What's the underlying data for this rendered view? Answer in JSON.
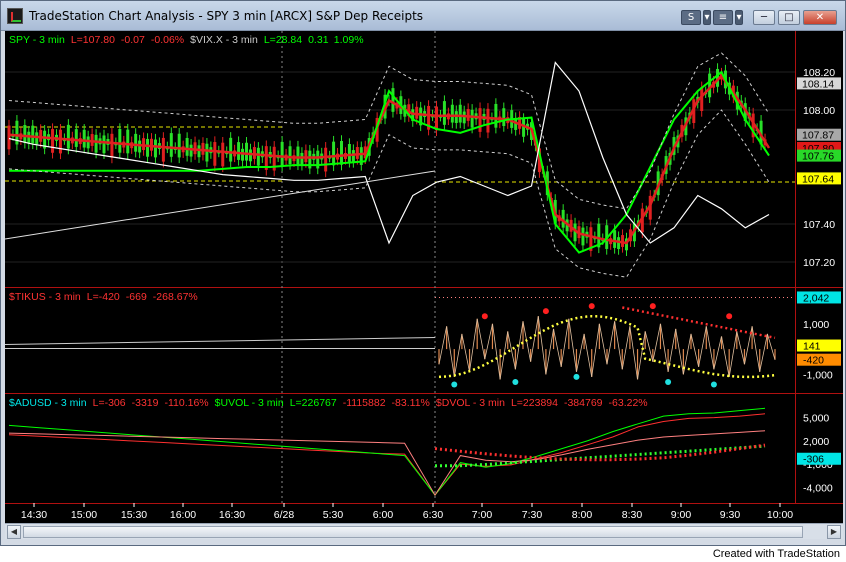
{
  "window": {
    "title": "TradeStation Chart Analysis - SPY 3 min [ARCX] S&P Dep Receipts",
    "btn_s": "S",
    "btn_menu": "≡"
  },
  "footer": "Created with TradeStation",
  "chart_data": [
    {
      "type": "line",
      "legend": [
        {
          "text": "SPY - 3 min",
          "color": "#00ff00"
        },
        {
          "text": "L=107.80",
          "color": "#ff3333"
        },
        {
          "text": "-0.07",
          "color": "#ff3333"
        },
        {
          "text": "-0.06%",
          "color": "#ff3333"
        },
        {
          "text": "$VIX.X - 3 min",
          "color": "#cccccc"
        },
        {
          "text": "L=28.84",
          "color": "#00ff00"
        },
        {
          "text": "0.31",
          "color": "#00ff00"
        },
        {
          "text": "1.09%",
          "color": "#00ff00"
        }
      ],
      "y_ticks": [
        "108.20",
        "108.00",
        "107.40",
        "107.20"
      ],
      "y_badges": [
        {
          "text": "108.14",
          "bg": "#d8d8d8",
          "fg": "#000000"
        },
        {
          "text": "107.87",
          "bg": "#a8a8a8",
          "fg": "#000000"
        },
        {
          "text": "107.80",
          "bg": "#e01818",
          "fg": "#000000"
        },
        {
          "text": "107.76",
          "bg": "#28d828",
          "fg": "#000000"
        },
        {
          "text": "107.64",
          "bg": "#ffff00",
          "fg": "#000000"
        }
      ],
      "ylim": [
        107.1,
        108.3
      ],
      "x": [
        0,
        3,
        6,
        9,
        12,
        15,
        18,
        21,
        24,
        27,
        30,
        33,
        36,
        39,
        42,
        45,
        48,
        51,
        54,
        57,
        60,
        63,
        66,
        69,
        72,
        75,
        78,
        81,
        84,
        87,
        90,
        93,
        96
      ],
      "series": [
        {
          "color": "#e02020",
          "values": [
            107.87,
            107.86,
            107.85,
            107.84,
            107.83,
            107.82,
            107.81,
            107.8,
            107.79,
            107.78,
            107.77,
            107.76,
            107.75,
            107.75,
            107.76,
            107.77,
            108.05,
            107.98,
            107.97,
            107.97,
            107.96,
            107.95,
            107.9,
            107.45,
            107.35,
            107.32,
            107.3,
            107.5,
            107.8,
            108.05,
            108.18,
            108.0,
            107.8
          ]
        },
        {
          "color": "#00ff00",
          "values": [
            107.68,
            107.68,
            107.68,
            107.68,
            107.68,
            107.68,
            107.68,
            107.68,
            107.68,
            107.69,
            107.7,
            107.7,
            107.71,
            107.71,
            107.72,
            107.73,
            108.1,
            107.95,
            107.9,
            107.88,
            107.92,
            107.95,
            107.96,
            107.4,
            107.25,
            107.3,
            107.45,
            107.7,
            107.95,
            108.1,
            108.2,
            107.95,
            107.76
          ]
        },
        {
          "color": "#ffffff",
          "values": [
            107.85,
            107.82,
            107.8,
            107.78,
            107.76,
            107.74,
            107.72,
            107.7,
            107.68,
            107.66,
            107.65,
            107.64,
            107.63,
            107.63,
            107.64,
            107.65,
            107.3,
            107.55,
            107.62,
            107.65,
            107.6,
            107.55,
            107.6,
            108.25,
            108.1,
            107.75,
            107.45,
            107.3,
            107.38,
            107.55,
            107.48,
            107.38,
            107.45
          ]
        }
      ]
    },
    {
      "type": "bar",
      "legend": [
        {
          "text": "$TIKUS - 3 min",
          "color": "#ff3333"
        },
        {
          "text": "L=-420",
          "color": "#ff3333"
        },
        {
          "text": "-669",
          "color": "#ff3333"
        },
        {
          "text": "-268.67%",
          "color": "#ff3333"
        }
      ],
      "y_ticks": [
        "1,000",
        "-1,000"
      ],
      "y_badges": [
        {
          "text": "2,042",
          "bg": "#00e5e5",
          "fg": "#000000"
        },
        {
          "text": "141",
          "bg": "#ffff00",
          "fg": "#000000"
        },
        {
          "text": "-420",
          "bg": "#ff8c00",
          "fg": "#000000"
        }
      ],
      "ylim": [
        -1500,
        2100
      ],
      "values": [
        -600,
        900,
        -1100,
        600,
        -900,
        1200,
        -400,
        1000,
        -1200,
        700,
        -800,
        1100,
        -500,
        1300,
        -1000,
        800,
        -700,
        1200,
        -900,
        600,
        -1100,
        1000,
        -600,
        1100,
        -800,
        900,
        -1200,
        700,
        -500,
        1000,
        -900,
        800,
        -1000,
        600,
        -700,
        900,
        -800,
        500,
        -1100,
        700,
        -600,
        900,
        -900,
        600,
        -420
      ],
      "flat_level": 141
    },
    {
      "type": "line",
      "legend": [
        {
          "text": "$ADUSD - 3 min",
          "color": "#00e5e5"
        },
        {
          "text": "L=-306",
          "color": "#ff3333"
        },
        {
          "text": "-3319",
          "color": "#ff3333"
        },
        {
          "text": "-110.16%",
          "color": "#ff3333"
        },
        {
          "text": "$UVOL - 3 min",
          "color": "#00ff00"
        },
        {
          "text": "L=226767",
          "color": "#00ff00"
        },
        {
          "text": "-1115882",
          "color": "#ff3333"
        },
        {
          "text": "-83.11%",
          "color": "#ff3333"
        },
        {
          "text": "$DVOL - 3 min",
          "color": "#ff3333"
        },
        {
          "text": "L=223894",
          "color": "#ff3333"
        },
        {
          "text": "-384769",
          "color": "#ff3333"
        },
        {
          "text": "-63.22%",
          "color": "#ff3333"
        }
      ],
      "y_ticks": [
        "5,000",
        "2,000",
        "-1,000",
        "-4,000"
      ],
      "y_badges": [
        {
          "text": "-306",
          "bg": "#00e5e5",
          "fg": "#000000"
        }
      ],
      "ylim": [
        -5500,
        6500
      ],
      "series": [
        {
          "name": "$ADUSD",
          "color": "#ff3030",
          "values": [
            2800,
            2600,
            2400,
            2200,
            2000,
            1800,
            1600,
            1400,
            1200,
            1000,
            800,
            600,
            400,
            300,
            -5000,
            -1000,
            -1300,
            -1100,
            -300,
            500,
            1500,
            2500,
            3800,
            4500,
            4900,
            5000,
            5200,
            5500
          ]
        },
        {
          "name": "$UVOL",
          "color": "#00ff00",
          "values": [
            4000,
            3700,
            3400,
            3100,
            2800,
            2500,
            2200,
            1900,
            1600,
            1300,
            1000,
            700,
            400,
            100,
            -5000,
            -800,
            -1400,
            -900,
            0,
            1000,
            2000,
            3200,
            4200,
            5200,
            5500,
            5600,
            5900,
            6200
          ]
        },
        {
          "name": "$DVOL",
          "color": "#ff8080",
          "values": [
            3000,
            2900,
            2800,
            2700,
            2600,
            2500,
            2400,
            2300,
            2200,
            2100,
            2000,
            1900,
            1800,
            1700,
            -5000,
            100,
            -500,
            -700,
            -400,
            200,
            900,
            1500,
            2100,
            2500,
            2700,
            2900,
            3100,
            3300
          ]
        }
      ]
    }
  ],
  "x_axis": {
    "labels": [
      "14:30",
      "15:00",
      "15:30",
      "16:00",
      "16:30",
      "6/28",
      "5:30",
      "6:00",
      "6:30",
      "7:00",
      "7:30",
      "8:00",
      "8:30",
      "9:00",
      "9:30",
      "10:00"
    ]
  }
}
